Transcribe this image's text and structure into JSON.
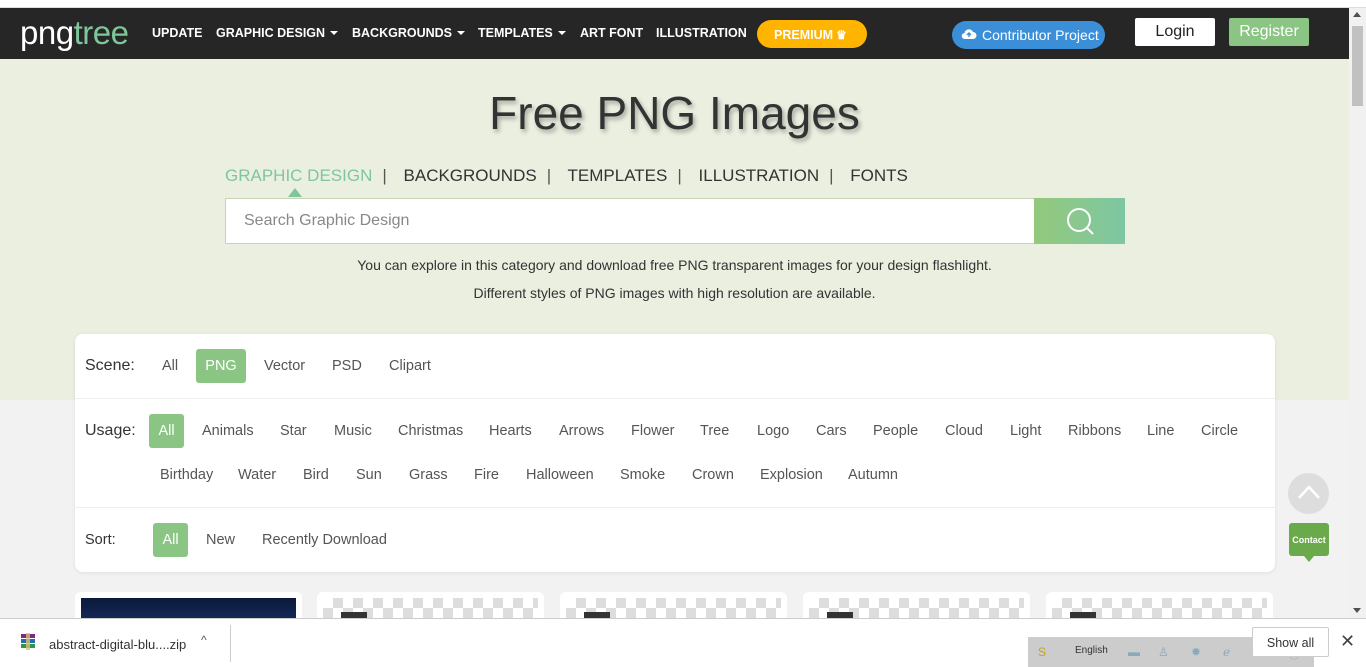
{
  "nav": {
    "logo_a": "png",
    "logo_b": "tree",
    "items": [
      "UPDATE",
      "GRAPHIC DESIGN",
      "BACKGROUNDS",
      "TEMPLATES",
      "ART FONT",
      "ILLUSTRATION"
    ],
    "premium": "PREMIUM",
    "contributor": "Contributor Project",
    "login": "Login",
    "register": "Register"
  },
  "hero": {
    "title": "Free PNG Images",
    "categories": [
      "GRAPHIC DESIGN",
      "BACKGROUNDS",
      "TEMPLATES",
      "ILLUSTRATION",
      "FONTS"
    ],
    "search_placeholder": "Search Graphic Design",
    "desc1": "You can explore in this category and download free PNG transparent images for your design flashlight.",
    "desc2": "Different styles of PNG images with high resolution are available."
  },
  "filters": {
    "scene_label": "Scene:",
    "scene": [
      "All",
      "PNG",
      "Vector",
      "PSD",
      "Clipart"
    ],
    "usage_label": "Usage:",
    "usage_row1": [
      "All",
      "Animals",
      "Star",
      "Music",
      "Christmas",
      "Hearts",
      "Arrows",
      "Flower",
      "Tree",
      "Logo",
      "Cars",
      "People",
      "Cloud",
      "Light",
      "Ribbons",
      "Line",
      "Circle"
    ],
    "usage_row2": [
      "Birthday",
      "Water",
      "Bird",
      "Sun",
      "Grass",
      "Fire",
      "Halloween",
      "Smoke",
      "Crown",
      "Explosion",
      "Autumn"
    ],
    "sort_label": "Sort:",
    "sort": [
      "All",
      "New",
      "Recently Download"
    ]
  },
  "float": {
    "contact": "Contact"
  },
  "download_bar": {
    "file": "abstract-digital-blu....zip",
    "language": "English",
    "show_all": "Show all"
  },
  "colors": {
    "accent": "#8bc584",
    "hero_bg": "#eaefe0",
    "nav_bg": "#262626",
    "premium": "#ffb400",
    "contributor": "#3b8fd8"
  }
}
